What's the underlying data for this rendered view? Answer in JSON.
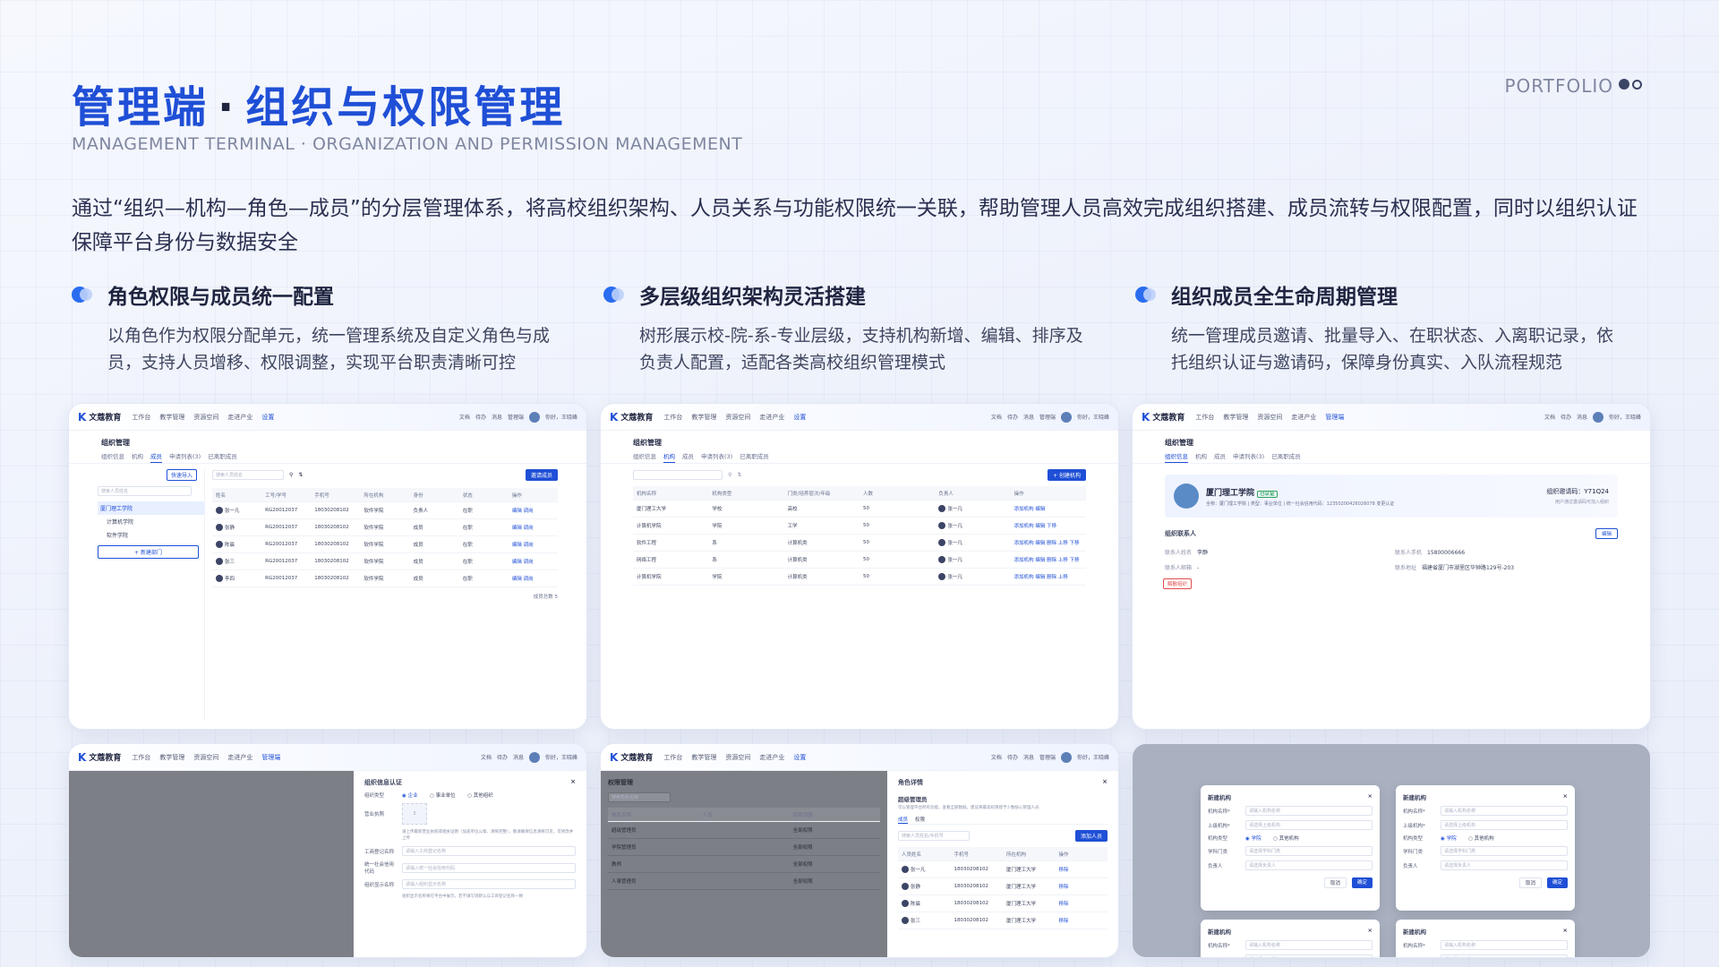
{
  "header": {
    "title_main": "管理端",
    "title_dot": "·",
    "title_rest": "组织与权限管理",
    "subtitle": "MANAGEMENT TERMINAL · ORGANIZATION AND PERMISSION MANAGEMENT",
    "portfolio": "PORTFOLIO"
  },
  "intro": "通过“组织—机构—角色—成员”的分层管理体系，将高校组织架构、人员关系与功能权限统一关联，帮助管理人员高效完成组织搭建、成员流转与权限配置，同时以组织认证保障平台身份与数据安全",
  "features": [
    {
      "title": "角色权限与成员统一配置",
      "desc": "以角色作为权限分配单元，统一管理系统及自定义角色与成员，支持人员增移、权限调整，实现平台职责清晰可控"
    },
    {
      "title": "多层级组织架构灵活搭建",
      "desc": "树形展示校-院-系-专业层级，支持机构新增、编辑、排序及负责人配置，适配各类高校组织管理模式"
    },
    {
      "title": "组织成员全生命周期管理",
      "desc": "统一管理成员邀请、批量导入、在职状态、入离职记录，依托组织认证与邀请码，保障身份真实、入队流程规范"
    }
  ],
  "app": {
    "logo": "文蔻教育",
    "nav": [
      "工作台",
      "教学管理",
      "资源空间",
      "走进产业",
      "设置"
    ],
    "tools": [
      "文档",
      "待办",
      "消息",
      "管理端",
      "你好，王晓峰"
    ],
    "module_title": "组织管理",
    "tabs": [
      "组织信息",
      "机构",
      "成员",
      "申请列表(3)",
      "已离职成员"
    ]
  },
  "card1": {
    "import_btn": "快速导入",
    "add_btn": "邀请成员",
    "search_placeholder": "搜索人员姓名",
    "tree": [
      "厦门理工学院",
      "计算机学院",
      "软件学院"
    ],
    "add_dept": "+ 新建部门",
    "columns": [
      "姓名",
      "工号/学号",
      "手机号",
      "所在机构",
      "身份",
      "状态",
      "操作"
    ],
    "rows": [
      [
        "张一凡",
        "RG20012037",
        "18030208102",
        "软件学院",
        "负责人",
        "在职",
        "编辑 调岗"
      ],
      [
        "张静",
        "RG20012037",
        "18030208102",
        "软件学院",
        "成员",
        "在职",
        "编辑 调岗"
      ],
      [
        "陈晨",
        "RG20012037",
        "18030208102",
        "软件学院",
        "成员",
        "在职",
        "编辑 调岗"
      ],
      [
        "张三",
        "RG20012037",
        "18030208102",
        "软件学院",
        "成员",
        "在职",
        "编辑 调岗"
      ],
      [
        "李四",
        "RG20012037",
        "18030208102",
        "软件学院",
        "成员",
        "在职",
        "编辑 调岗"
      ]
    ],
    "footer": "成员总数 5"
  },
  "card2": {
    "add_btn": "+ 创建机构",
    "columns": [
      "机构名称",
      "机构类型",
      "门类/培养层次/年级",
      "人数",
      "负责人",
      "操作"
    ],
    "rows": [
      [
        "厦门理工大学",
        "学校",
        "高校",
        "50",
        "张一凡",
        "添加机构 编辑"
      ],
      [
        "计算机学院",
        "学院",
        "工学",
        "50",
        "张一凡",
        "添加机构 编辑 下移"
      ],
      [
        "软件工程",
        "系",
        "计算机类",
        "50",
        "张一凡",
        "添加机构 编辑 删除 上移 下移"
      ],
      [
        "网络工程",
        "系",
        "计算机类",
        "50",
        "张一凡",
        "添加机构 编辑 删除 上移 下移"
      ],
      [
        "计算机学院",
        "学院",
        "计算机类",
        "50",
        "张一凡",
        "添加机构 编辑 删除 上移"
      ]
    ]
  },
  "card3": {
    "org_name": "厦门理工学院",
    "verified": "已认证",
    "info": "全称：厦门理工学院 | 类型：事业单位 | 统一社会信用代码：12350200426026078 变更认证",
    "invite_code": "组织邀请码：Y71Q24",
    "invite_hint": "用户通过邀请码可加入组织",
    "contact_title": "组织联系人",
    "edit": "编辑",
    "fields": [
      [
        "联系人姓名",
        "李静"
      ],
      [
        "联系人手机",
        "15800006666"
      ],
      [
        "联系人邮箱",
        "-"
      ],
      [
        "联系地址",
        "福建省厦门市湖里区华钟路129号-203"
      ]
    ],
    "dissolve": "解散组织"
  },
  "card4": {
    "drawer_title": "组织信息认证",
    "org_type": "组织类型",
    "types": [
      "企业",
      "事业单位",
      "其他组织"
    ],
    "license": "营业执照",
    "license_hint": "请上传最新营业执照或相关证明（加盖单位公章、清晰完整），敬请确保信息清晰可见，可修改并上传",
    "fields": [
      [
        "工商登记名称",
        "请输入工商登记名称"
      ],
      [
        "统一社会信用代码",
        "请输入统一社会信用代码"
      ],
      [
        "组织显示名称",
        "请输入组织显示名称"
      ]
    ],
    "foot_hint": "组织显示名称将在平台中展示，若不填写则默认与工商登记名称一致"
  },
  "card5": {
    "drawer_title": "角色详情",
    "role_name": "超级管理员",
    "role_desc": "可以管理平台所有功能，查看全部数据，建议将最高权限授予少数核心管理人员",
    "tabs": [
      "成员",
      "权限"
    ],
    "add_btn": "添加人员",
    "search_placeholder": "搜索人员姓名/手机号",
    "columns": [
      "人员姓名",
      "手机号",
      "所在机构",
      "操作"
    ],
    "rows": [
      [
        "张一凡",
        "18030208102",
        "厦门理工大学",
        "移除"
      ],
      [
        "张静",
        "18030208102",
        "厦门理工大学",
        "移除"
      ],
      [
        "陈晨",
        "18030208102",
        "厦门理工大学",
        "移除"
      ],
      [
        "张三",
        "18030208102",
        "厦门理工大学",
        "移除"
      ]
    ],
    "bg_module": "权限管理",
    "bg_search": "搜索角色名称",
    "bg_cols": [
      "角色名称",
      "人员",
      "权限范围"
    ],
    "bg_rows": [
      [
        "超级管理员",
        "全部权限"
      ],
      [
        "学院管理员",
        "全部权限"
      ],
      [
        "教师",
        "全部权限"
      ],
      [
        "人事管理员",
        "全部权限"
      ]
    ]
  },
  "card6": {
    "modal_title": "新建机构",
    "fields": [
      [
        "机构名称*",
        "请输入机构名称"
      ],
      [
        "上级机构*",
        "请选择上级机构"
      ],
      [
        "机构类型",
        ""
      ],
      [
        "学科门类",
        "请选择学科门类"
      ],
      [
        "负责人",
        "请选择负责人"
      ]
    ],
    "types": [
      "学院",
      "其他机构"
    ],
    "cancel": "取消",
    "confirm": "确定"
  },
  "colors": {
    "accent": "#1f4fd6",
    "title_dark": "#1f2540",
    "muted": "#7f86a0"
  }
}
